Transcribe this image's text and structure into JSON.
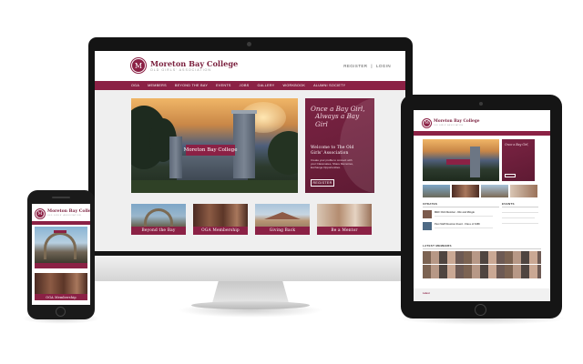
{
  "site": {
    "name": "Moreton Bay College",
    "subtitle": "Old Girls' Association",
    "crest_letter": "M",
    "header_links": {
      "register": "REGISTER",
      "separator": "|",
      "login": "LOGIN"
    },
    "nav": [
      "OGA",
      "MEMBERS",
      "BEYOND THE BAY",
      "EVENTS",
      "JOBS",
      "GALLERY",
      "WORKBOOK",
      "ALUMNI SOCIETY"
    ],
    "hero_sign": "Moreton Bay College",
    "panel": {
      "script_line1": "Once a Bay Girl,",
      "script_line2": "Always a Bay Girl",
      "welcome": "Welcome to The Old Girls' Association",
      "body": "Create your profile to connect with your Classmates, Share Memories, Exchange Opportunities.",
      "button": "REGISTER"
    },
    "tiles": [
      "Beyond the Bay",
      "OGA Membership",
      "Giving Back",
      "Be a Mentor"
    ]
  },
  "ipad": {
    "sections": {
      "updates": "UPDATES",
      "events": "EVENTS",
      "members": "LATEST MEMBERS"
    },
    "news": [
      "MBC OGA Member - Mix and Mingle",
      "Past Staff Reunion Event - Class of 1986"
    ],
    "footer": "Latest"
  },
  "colors": {
    "brand": "#8b2145",
    "brand_dark": "#5e1a33",
    "device": "#141414"
  }
}
